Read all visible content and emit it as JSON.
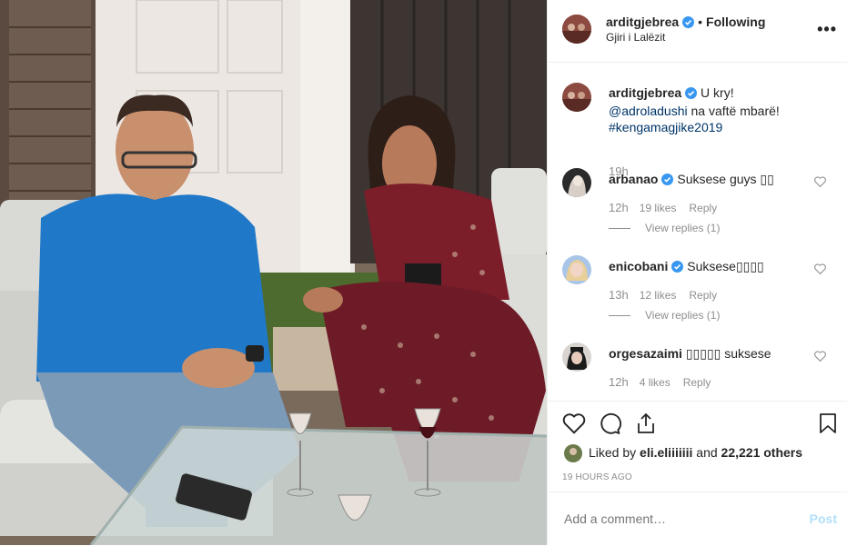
{
  "header": {
    "username": "arditgjebrea",
    "separator": "•",
    "following": "Following",
    "location": "Gjiri i Lalëzit",
    "more": "•••"
  },
  "caption": {
    "username": "arditgjebrea",
    "text1": "U kry!",
    "mention": "@adroladushi",
    "text2": "na vaftë mbarë!",
    "hashtag": "#kengamagjike2019",
    "time": "19h"
  },
  "comments": [
    {
      "username": "arbanao",
      "verified": true,
      "text": "Suksese guys ▯▯",
      "time": "12h",
      "likes": "19 likes",
      "reply": "Reply",
      "view_replies": "View replies (1)"
    },
    {
      "username": "enicobani",
      "verified": true,
      "text": "Suksese▯▯▯▯",
      "time": "13h",
      "likes": "12 likes",
      "reply": "Reply",
      "view_replies": "View replies (1)"
    },
    {
      "username": "orgesazaimi",
      "verified": false,
      "text": "▯▯▯▯▯ suksese",
      "time": "12h",
      "likes": "4 likes",
      "reply": "Reply"
    }
  ],
  "actions": {
    "liked_by_prefix": "Liked by",
    "liked_by_user": "eli.eliiiiiii",
    "liked_by_and": "and",
    "liked_by_count": "22,221 others",
    "time_ago": "19 HOURS AGO"
  },
  "add_comment": {
    "placeholder": "Add a comment…",
    "post_label": "Post"
  },
  "colors": {
    "verified": "#3897f0",
    "link": "#003569",
    "muted": "#8e8e8e",
    "post_disabled": "#b2dffc"
  }
}
